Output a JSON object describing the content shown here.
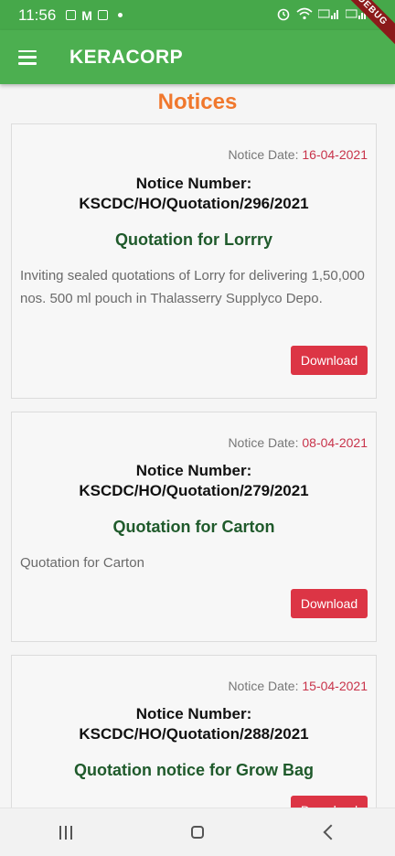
{
  "status_bar": {
    "time": "11:56",
    "debug_label": "DEBUG",
    "carrier1": "Vo)) LTE1",
    "carrier2": "Vo)) LTE2"
  },
  "app_bar": {
    "title": "KERACORP"
  },
  "page": {
    "title": "Notices"
  },
  "notices": [
    {
      "date_label": "Notice Date: ",
      "date": "16-04-2021",
      "number_label": "Notice Number:",
      "number": "KSCDC/HO/Quotation/296/2021",
      "title": "Quotation for Lorrry",
      "description": "Inviting sealed quotations of Lorry for delivering 1,50,000 nos. 500 ml pouch in Thalasserry Supplyco Depo.",
      "button": "Download"
    },
    {
      "date_label": "Notice Date: ",
      "date": "08-04-2021",
      "number_label": "Notice Number:",
      "number": "KSCDC/HO/Quotation/279/2021",
      "title": "Quotation for Carton",
      "description": "Quotation for Carton",
      "button": "Download"
    },
    {
      "date_label": "Notice Date: ",
      "date": "15-04-2021",
      "number_label": "Notice Number:",
      "number": "KSCDC/HO/Quotation/288/2021",
      "title": "Quotation notice for Grow Bag",
      "description": "",
      "button": "Download"
    }
  ],
  "colors": {
    "appbar": "#4caf50",
    "title_orange": "#f0782d",
    "date_red": "#c8334a",
    "button_red": "#dc3545",
    "card_title_green": "#1f5a2b"
  }
}
